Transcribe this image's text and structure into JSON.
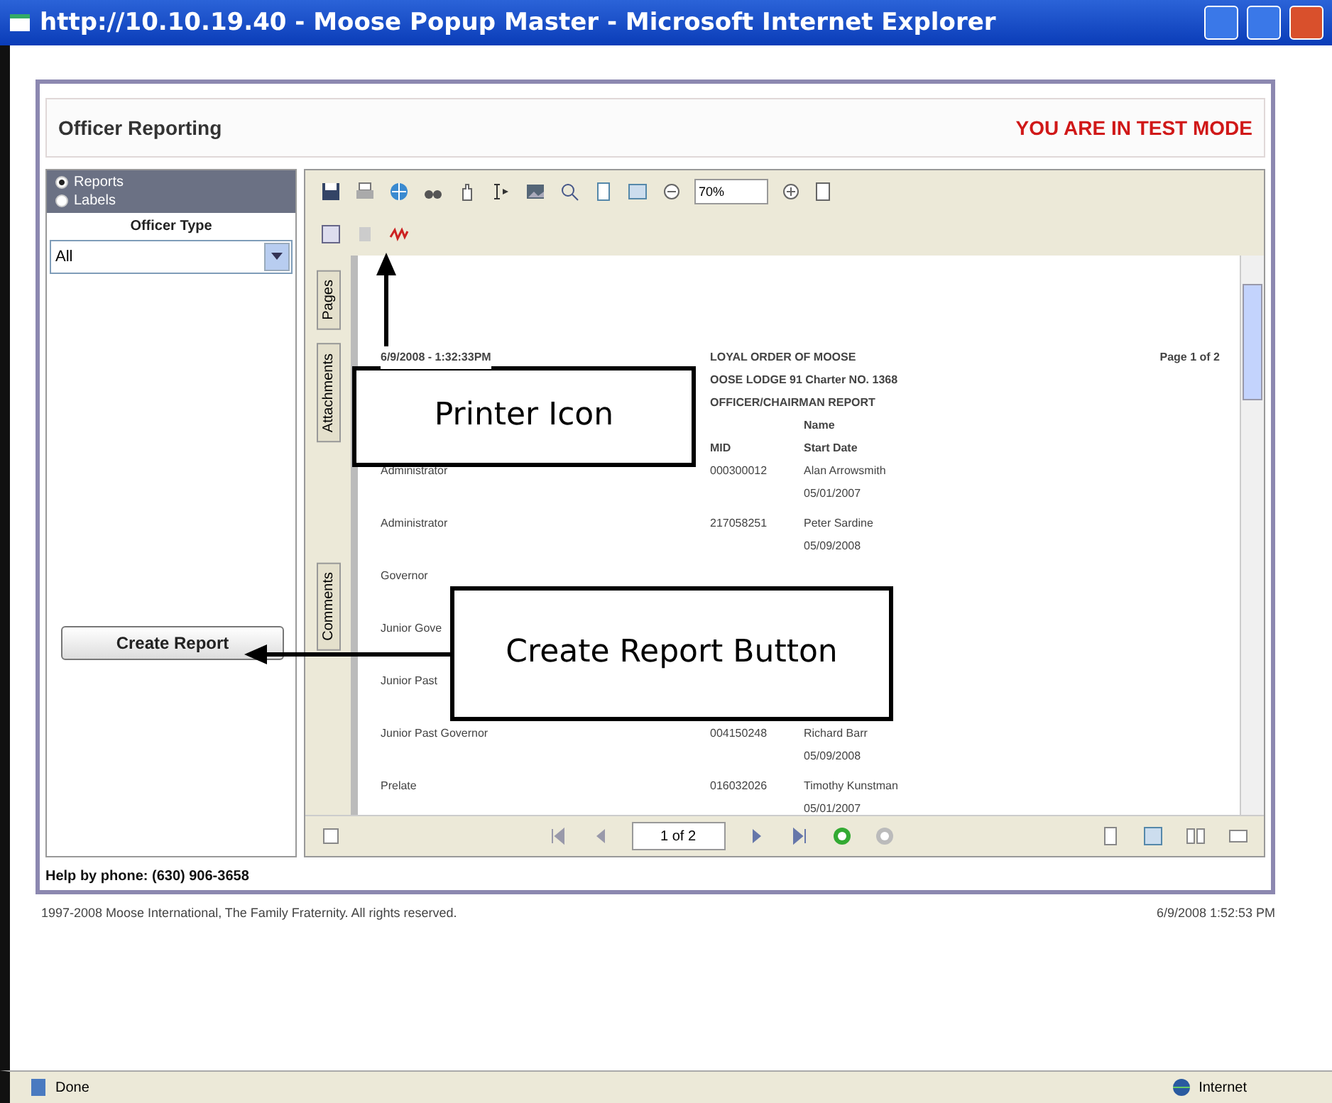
{
  "window": {
    "title": "http://10.10.19.40 - Moose Popup Master - Microsoft Internet Explorer"
  },
  "header": {
    "title": "Officer Reporting",
    "mode_notice": "YOU ARE IN TEST MODE"
  },
  "sidebar": {
    "options": [
      {
        "label": "Reports",
        "selected": true
      },
      {
        "label": "Labels",
        "selected": false
      }
    ],
    "filter_label": "Officer Type",
    "filter_value": "All",
    "button": "Create Report"
  },
  "viewer": {
    "zoom": "70%",
    "side_tabs": [
      "Pages",
      "Attachments",
      "Comments"
    ],
    "page_indicator": "1 of 2",
    "report": {
      "timestamp": "6/9/2008 - 1:32:33PM",
      "titles": [
        "LOYAL ORDER OF MOOSE",
        "OOSE LODGE 91 Charter NO. 1368",
        "OFFICER/CHAIRMAN REPORT"
      ],
      "page": "Page 1 of 2",
      "columns": [
        "MID",
        "Name",
        "Start Date"
      ],
      "rows": [
        {
          "office": "Administrator",
          "mid": "000300012",
          "name": "Alan Arrowsmith",
          "date": "05/01/2007"
        },
        {
          "office": "Administrator",
          "mid": "217058251",
          "name": "Peter Sardine",
          "date": "05/09/2008"
        },
        {
          "office": "Governor",
          "mid": "",
          "name": "",
          "date": ""
        },
        {
          "office": "Junior Gove",
          "mid": "",
          "name": "",
          "date": ""
        },
        {
          "office": "Junior Past",
          "mid": "",
          "name": "",
          "date": ""
        },
        {
          "office": "Junior Past Governor",
          "mid": "004150248",
          "name": "Richard Barr",
          "date": "05/09/2008"
        },
        {
          "office": "Prelate",
          "mid": "016032026",
          "name": "Timothy Kunstman",
          "date": "05/01/2007"
        }
      ]
    }
  },
  "help": "Help by phone: (630) 906-3658",
  "footer": {
    "copyright": "1997-2008 Moose International, The Family Fraternity. All rights reserved.",
    "datetime": "6/9/2008 1:52:53 PM"
  },
  "status_bar": {
    "status": "Done",
    "zone": "Internet"
  },
  "callouts": [
    {
      "kind": "up",
      "text": "Printer Icon"
    },
    {
      "kind": "left",
      "text": "Create Report Button"
    }
  ]
}
